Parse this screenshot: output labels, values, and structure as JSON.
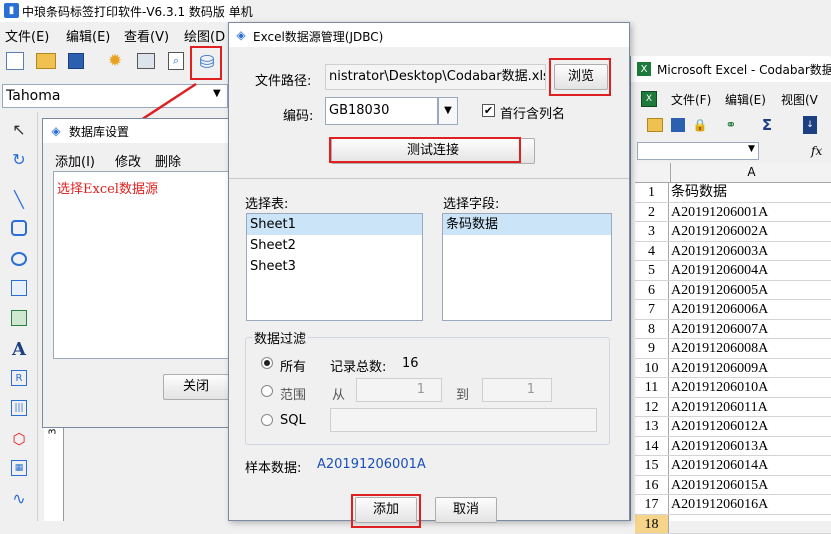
{
  "main": {
    "title": "中琅条码标签打印软件-V6.3.1 数码版 单机",
    "menu": [
      "文件(E)",
      "编辑(E)",
      "查看(V)",
      "绘图(D"
    ],
    "font_name": "Tahoma"
  },
  "db_settings": {
    "title": "数据库设置",
    "actions": [
      "添加(I)",
      "修改",
      "删除"
    ],
    "annotation": "选择Excel数据源",
    "close_label": "关闭"
  },
  "jdbc": {
    "title": "Excel数据源管理(JDBC)",
    "file_path_label": "文件路径:",
    "file_path_value": "nistrator\\Desktop\\Codabar数据.xls",
    "browse_label": "浏览",
    "encoding_label": "编码:",
    "encoding_value": "GB18030",
    "first_row_label": "首行含列名",
    "test_label": "测试连接",
    "select_table_label": "选择表:",
    "tables": [
      "Sheet1",
      "Sheet2",
      "Sheet3"
    ],
    "select_field_label": "选择字段:",
    "fields": [
      "条码数据"
    ],
    "filter_label": "数据过滤",
    "all_label": "所有",
    "total_label": "记录总数:",
    "total_value": "16",
    "range_label": "范围",
    "from_label": "从",
    "from_value": "1",
    "to_label": "到",
    "to_value": "1",
    "sql_label": "SQL",
    "sample_label": "样本数据:",
    "sample_value": "A20191206001A",
    "add_label": "添加",
    "cancel_label": "取消"
  },
  "excel": {
    "title": "Microsoft Excel - Codabar数据.",
    "menu": [
      "文件(F)",
      "编辑(E)",
      "视图(V"
    ],
    "column": "A",
    "rows": [
      {
        "n": "1",
        "v": "条码数据"
      },
      {
        "n": "2",
        "v": "A20191206001A"
      },
      {
        "n": "3",
        "v": "A20191206002A"
      },
      {
        "n": "4",
        "v": "A20191206003A"
      },
      {
        "n": "5",
        "v": "A20191206004A"
      },
      {
        "n": "6",
        "v": "A20191206005A"
      },
      {
        "n": "7",
        "v": "A20191206006A"
      },
      {
        "n": "8",
        "v": "A20191206007A"
      },
      {
        "n": "9",
        "v": "A20191206008A"
      },
      {
        "n": "10",
        "v": "A20191206009A"
      },
      {
        "n": "11",
        "v": "A20191206010A"
      },
      {
        "n": "12",
        "v": "A20191206011A"
      },
      {
        "n": "13",
        "v": "A20191206012A"
      },
      {
        "n": "14",
        "v": "A20191206013A"
      },
      {
        "n": "15",
        "v": "A20191206014A"
      },
      {
        "n": "16",
        "v": "A20191206015A"
      },
      {
        "n": "17",
        "v": "A20191206016A"
      },
      {
        "n": "18",
        "v": ""
      }
    ]
  }
}
